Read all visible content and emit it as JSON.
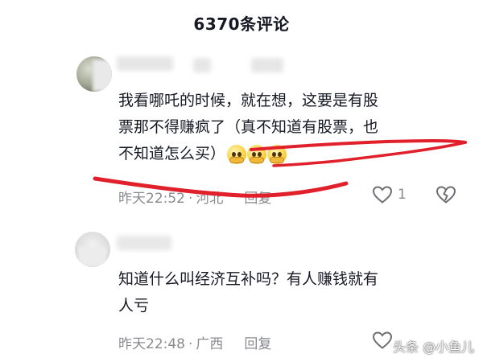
{
  "header": {
    "title": "6370条评论"
  },
  "comments": [
    {
      "lines": [
        "我看哪吒的时候，就在想，这要是有股",
        "票那不得赚疯了（真不知道有股票，也",
        "不知道怎么买）"
      ],
      "meta": {
        "time": "昨天22:52",
        "location": "河北",
        "reply": "回复"
      },
      "likes": "1"
    },
    {
      "lines": [
        "知道什么叫经济互补吗？有人赚钱就有",
        "人亏"
      ],
      "meta": {
        "time": "昨天22:48",
        "location": "广西",
        "reply": "回复"
      },
      "likes": ""
    }
  ],
  "watermark": "头条 @小鱼儿",
  "icons": {
    "like": "heart-icon",
    "dislike": "broken-heart-icon",
    "emoji": "pleading-face-emoji"
  },
  "colors": {
    "text": "#161823",
    "meta": "#8a8b91",
    "annotation": "#e0202a"
  }
}
